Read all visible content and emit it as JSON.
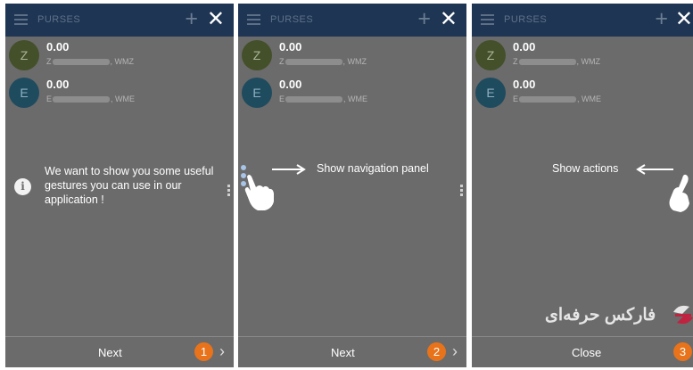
{
  "app": {
    "title": "PURSES",
    "purses": [
      {
        "letter": "Z",
        "amount": "0.00",
        "wallet_prefix": "Z",
        "wallet_suffix": ", WMZ"
      },
      {
        "letter": "E",
        "amount": "0.00",
        "wallet_prefix": "E",
        "wallet_suffix": ", WME"
      }
    ]
  },
  "screens": [
    {
      "message": "We want to show you some useful gestures you can use in our application !",
      "button": "Next",
      "step": "1"
    },
    {
      "message": "Show navigation panel",
      "button": "Next",
      "step": "2"
    },
    {
      "message": "Show actions",
      "button": "Close",
      "step": "3"
    }
  ],
  "watermark": {
    "text": "فارکس حرفه‌ای"
  },
  "colors": {
    "topbar": "#1e3553",
    "overlay": "#6b6b6b",
    "step_badge": "#e8731a"
  }
}
